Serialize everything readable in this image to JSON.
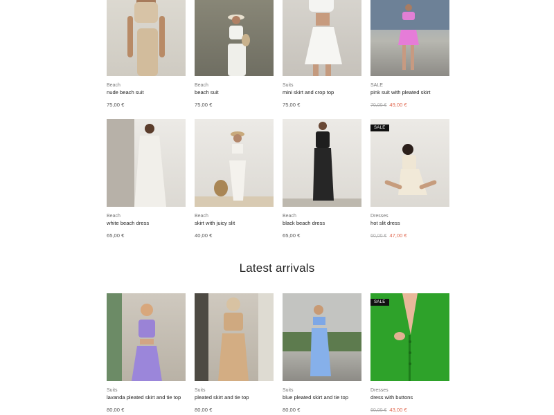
{
  "row1": [
    {
      "category": "Beach",
      "name": "nude beach suit",
      "price": "75,00 €",
      "old_price": "",
      "new_price": "",
      "sale_badge": ""
    },
    {
      "category": "Beach",
      "name": "beach suit",
      "price": "75,00 €",
      "old_price": "",
      "new_price": "",
      "sale_badge": ""
    },
    {
      "category": "Suits",
      "name": "mini skirt and crop top",
      "price": "75,00 €",
      "old_price": "",
      "new_price": "",
      "sale_badge": ""
    },
    {
      "category": "SALE",
      "name": "pink suit with pleated skirt",
      "price": "",
      "old_price": "70,00 €",
      "new_price": "49,00 €",
      "sale_badge": ""
    }
  ],
  "row2": [
    {
      "category": "Beach",
      "name": "white beach dress",
      "price": "65,00 €",
      "old_price": "",
      "new_price": "",
      "sale_badge": ""
    },
    {
      "category": "Beach",
      "name": "skirt with juicy slit",
      "price": "40,00 €",
      "old_price": "",
      "new_price": "",
      "sale_badge": ""
    },
    {
      "category": "Beach",
      "name": "black beach dress",
      "price": "65,00 €",
      "old_price": "",
      "new_price": "",
      "sale_badge": ""
    },
    {
      "category": "Dresses",
      "name": "hot slit dress",
      "price": "",
      "old_price": "60,00 €",
      "new_price": "47,00 €",
      "sale_badge": "SALE"
    }
  ],
  "latest_title": "Latest arrivals",
  "row3": [
    {
      "category": "Suits",
      "name": "lavanda pleated skirt and tie top",
      "price": "80,00 €",
      "old_price": "",
      "new_price": "",
      "sale_badge": ""
    },
    {
      "category": "Suits",
      "name": "pleated skirt and tie top",
      "price": "80,00 €",
      "old_price": "",
      "new_price": "",
      "sale_badge": ""
    },
    {
      "category": "Suits",
      "name": "blue pleated skirt and tie top",
      "price": "80,00 €",
      "old_price": "",
      "new_price": "",
      "sale_badge": ""
    },
    {
      "category": "Dresses",
      "name": "dress with buttons",
      "price": "",
      "old_price": "60,00 €",
      "new_price": "43,00 €",
      "sale_badge": "SALE"
    }
  ],
  "colors": {
    "sale_price": "#e06a52",
    "old_price": "#aaaaaa",
    "badge_bg": "#111111"
  }
}
